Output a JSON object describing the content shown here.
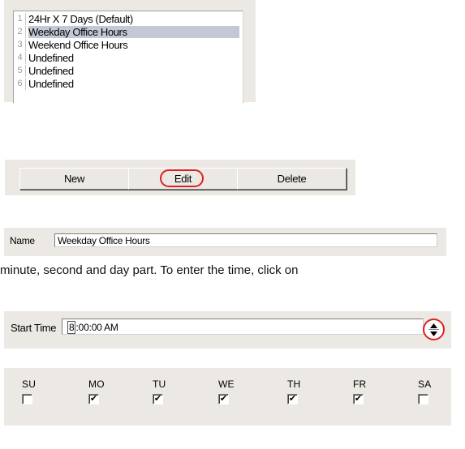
{
  "list": {
    "items": [
      {
        "num": "1",
        "label": "24Hr X 7 Days (Default)",
        "selected": false
      },
      {
        "num": "2",
        "label": "Weekday Office Hours",
        "selected": true
      },
      {
        "num": "3",
        "label": "Weekend Office Hours",
        "selected": false
      },
      {
        "num": "4",
        "label": "Undefined",
        "selected": false
      },
      {
        "num": "5",
        "label": "Undefined",
        "selected": false
      },
      {
        "num": "6",
        "label": "Undefined",
        "selected": false
      }
    ]
  },
  "buttons": {
    "new_label": "New",
    "edit_label": "Edit",
    "delete_label": "Delete",
    "highlight_color": "#e02020"
  },
  "name": {
    "label": "Name",
    "value": "Weekday Office Hours"
  },
  "instruction_text": "minute, second and day part. To enter the time, click on",
  "start_time": {
    "label": "Start Time",
    "cursor_part": "8",
    "value_rest": ":00:00 AM"
  },
  "days": [
    {
      "label": "SU",
      "checked": false
    },
    {
      "label": "MO",
      "checked": true
    },
    {
      "label": "TU",
      "checked": true
    },
    {
      "label": "WE",
      "checked": true
    },
    {
      "label": "TH",
      "checked": true
    },
    {
      "label": "FR",
      "checked": true
    },
    {
      "label": "SA",
      "checked": false
    }
  ],
  "colors": {
    "panel": "#ece9e4",
    "selection": "#c3c8d4"
  }
}
